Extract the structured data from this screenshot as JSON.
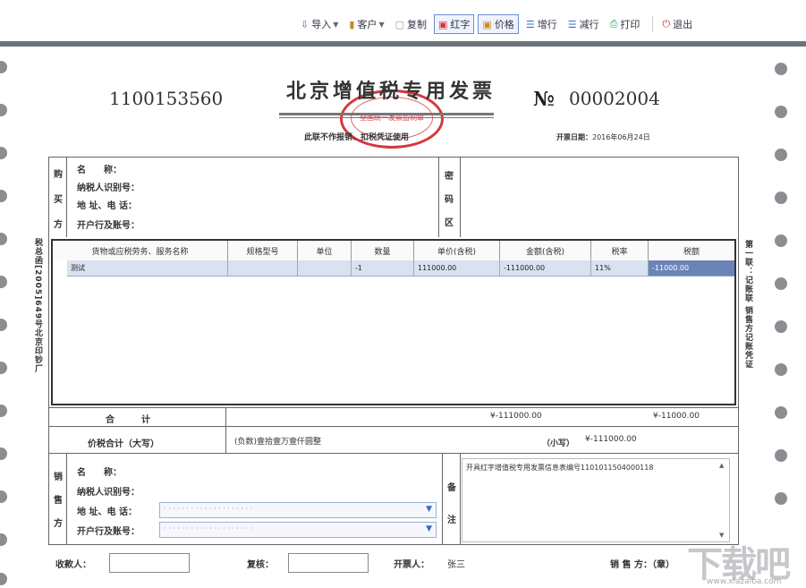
{
  "toolbar": {
    "import_label": "导入",
    "customer_label": "客户",
    "copy_label": "复制",
    "red_label": "红字",
    "price_label": "价格",
    "add_row_label": "增行",
    "del_row_label": "减行",
    "print_label": "打印",
    "exit_label": "退出"
  },
  "invoice": {
    "code": "1100153560",
    "title": "北京增值税专用发票",
    "subtitle": "此联不作报销、扣税凭证使用",
    "no_mark": "№",
    "number": "00002004",
    "date_label": "开票日期：",
    "date_value": "2016年06月24日",
    "seal_text": "全国统一发票监制章"
  },
  "buyer": {
    "section": [
      "购",
      "买",
      "方"
    ],
    "name_label": "名　　称：",
    "taxid_label": "纳税人识别号：",
    "address_label": "地 址、电 话：",
    "bank_label": "开户行及账号："
  },
  "cipher": {
    "section": [
      "密",
      "码",
      "区"
    ]
  },
  "items": {
    "headers": [
      "货物或应税劳务、服务名称",
      "规格型号",
      "单位",
      "数量",
      "单价(含税)",
      "金额(含税)",
      "税率",
      "税额"
    ],
    "rows": [
      [
        "测试",
        "",
        "",
        "-1",
        "111000.00",
        "-111000.00",
        "11%",
        "-11000.00"
      ]
    ]
  },
  "totals": {
    "label": "合　　　计",
    "amount": "¥-111000.00",
    "tax": "¥-11000.00",
    "sum_label": "价税合计（大写）",
    "sum_words": "(负数)壹拾壹万壹仟圆整",
    "small_label": "（小写）",
    "small_value": "¥-111000.00"
  },
  "seller": {
    "section": [
      "销",
      "售",
      "方"
    ],
    "name_label": "名　　称：",
    "taxid_label": "纳税人识别号：",
    "address_label": "地 址、电 话：",
    "bank_label": "开户行及账号："
  },
  "remark": {
    "section": [
      "备",
      "注"
    ],
    "text": "开具红字增值税专用发票信息表编号1101011504000118"
  },
  "side": {
    "left": "税总函[2005]649号北京印钞厂",
    "right": "第一联：记账联  销售方记账凭证"
  },
  "footer": {
    "payee_label": "收款人：",
    "reviewer_label": "复核：",
    "drawer_label": "开票人：",
    "drawer_value": "张三",
    "seller_label": "销 售 方：（章）"
  },
  "watermark": {
    "text": "下载吧",
    "url": "www.xiazaiba.com"
  }
}
